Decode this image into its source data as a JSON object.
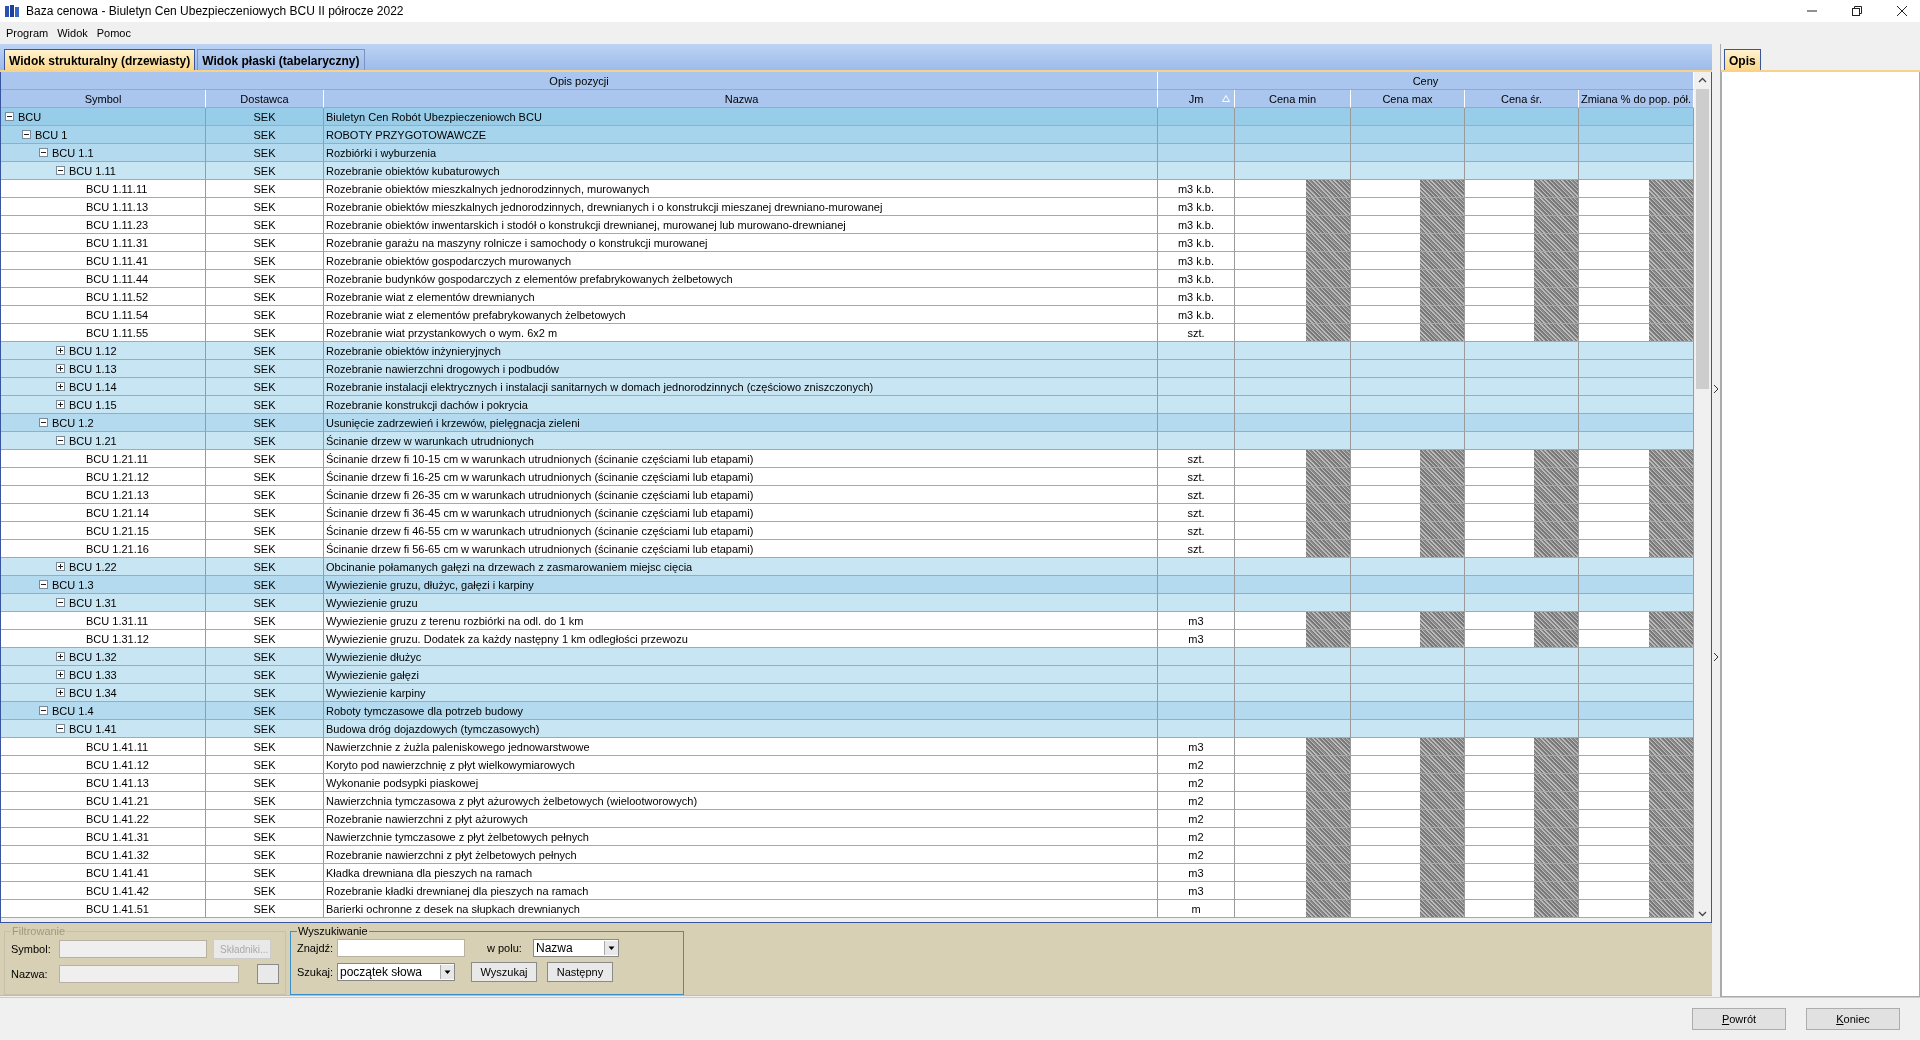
{
  "window": {
    "title": "Baza cenowa - Biuletyn Cen Ubezpieczeniowych BCU II półrocze 2022"
  },
  "menu": [
    "Program",
    "Widok",
    "Pomoc"
  ],
  "tabs": [
    {
      "label": "Widok strukturalny (drzewiasty)",
      "selected": true
    },
    {
      "label": "Widok płaski (tabelaryczny)",
      "selected": false
    }
  ],
  "table": {
    "column_groups": [
      "Opis pozycji",
      "Ceny"
    ],
    "columns": [
      "Symbol",
      "Dostawca",
      "Nazwa",
      "Jm",
      "Cena min",
      "Cena max",
      "Cena śr.",
      "Zmiana % do pop. pół."
    ],
    "rows": [
      {
        "symbol": "BCU",
        "supplier": "SEK",
        "name": "Biuletyn Cen Robót Ubezpieczeniowch BCU",
        "expanded": true,
        "children": [
          {
            "symbol": "BCU 1",
            "supplier": "SEK",
            "name": "ROBOTY PRZYGOTOWAWCZE",
            "expanded": true,
            "children": [
              {
                "symbol": "BCU 1.1",
                "supplier": "SEK",
                "name": "Rozbiórki i wyburzenia",
                "expanded": true,
                "children": [
                  {
                    "symbol": "BCU 1.11",
                    "supplier": "SEK",
                    "name": "Rozebranie obiektów kubaturowych",
                    "expanded": true,
                    "children": [
                      {
                        "symbol": "BCU 1.11.11",
                        "supplier": "SEK",
                        "name": "Rozebranie obiektów mieszkalnych jednorodzinnych, murowanych",
                        "unit": "m3 k.b.",
                        "prices_obscured": true
                      },
                      {
                        "symbol": "BCU 1.11.13",
                        "supplier": "SEK",
                        "name": "Rozebranie obiektów mieszkalnych jednorodzinnych, drewnianych i o konstrukcji mieszanej drewniano-murowanej",
                        "unit": "m3 k.b.",
                        "prices_obscured": true
                      },
                      {
                        "symbol": "BCU 1.11.23",
                        "supplier": "SEK",
                        "name": "Rozebranie obiektów inwentarskich i stodół o konstrukcji drewnianej, murowanej lub murowano-drewnianej",
                        "unit": "m3 k.b.",
                        "prices_obscured": true
                      },
                      {
                        "symbol": "BCU 1.11.31",
                        "supplier": "SEK",
                        "name": "Rozebranie garażu na maszyny rolnicze i samochody o konstrukcji murowanej",
                        "unit": "m3 k.b.",
                        "prices_obscured": true
                      },
                      {
                        "symbol": "BCU 1.11.41",
                        "supplier": "SEK",
                        "name": "Rozebranie obiektów gospodarczych murowanych",
                        "unit": "m3 k.b.",
                        "prices_obscured": true
                      },
                      {
                        "symbol": "BCU 1.11.44",
                        "supplier": "SEK",
                        "name": "Rozebranie budynków gospodarczych z elementów prefabrykowanych żelbetowych",
                        "unit": "m3 k.b.",
                        "prices_obscured": true
                      },
                      {
                        "symbol": "BCU 1.11.52",
                        "supplier": "SEK",
                        "name": "Rozebranie wiat z elementów drewnianych",
                        "unit": "m3 k.b.",
                        "prices_obscured": true
                      },
                      {
                        "symbol": "BCU 1.11.54",
                        "supplier": "SEK",
                        "name": "Rozebranie wiat z elementów prefabrykowanych żelbetowych",
                        "unit": "m3 k.b.",
                        "prices_obscured": true
                      },
                      {
                        "symbol": "BCU 1.11.55",
                        "supplier": "SEK",
                        "name": "Rozebranie wiat przystankowych o wym. 6x2 m",
                        "unit": "szt.",
                        "prices_obscured": true
                      }
                    ]
                  },
                  {
                    "symbol": "BCU 1.12",
                    "supplier": "SEK",
                    "name": "Rozebranie obiektów inżynieryjnych",
                    "expanded": false
                  },
                  {
                    "symbol": "BCU 1.13",
                    "supplier": "SEK",
                    "name": "Rozebranie nawierzchni drogowych i podbudów",
                    "expanded": false
                  },
                  {
                    "symbol": "BCU 1.14",
                    "supplier": "SEK",
                    "name": "Rozebranie instalacji elektrycznych i instalacji sanitarnych w domach jednorodzinnych (częściowo zniszczonych)",
                    "expanded": false
                  },
                  {
                    "symbol": "BCU 1.15",
                    "supplier": "SEK",
                    "name": "Rozebranie konstrukcji dachów i pokrycia",
                    "expanded": false
                  }
                ]
              },
              {
                "symbol": "BCU 1.2",
                "supplier": "SEK",
                "name": "Usunięcie zadrzewień i krzewów, pielęgnacja zieleni",
                "expanded": true,
                "children": [
                  {
                    "symbol": "BCU 1.21",
                    "supplier": "SEK",
                    "name": "Ścinanie drzew w warunkach utrudnionych",
                    "expanded": true,
                    "children": [
                      {
                        "symbol": "BCU 1.21.11",
                        "supplier": "SEK",
                        "name": "Ścinanie drzew fi 10-15 cm w warunkach utrudnionych (ścinanie częściami lub etapami)",
                        "unit": "szt.",
                        "prices_obscured": true
                      },
                      {
                        "symbol": "BCU 1.21.12",
                        "supplier": "SEK",
                        "name": "Ścinanie drzew fi 16-25 cm w warunkach utrudnionych (ścinanie częściami lub etapami)",
                        "unit": "szt.",
                        "prices_obscured": true
                      },
                      {
                        "symbol": "BCU 1.21.13",
                        "supplier": "SEK",
                        "name": "Ścinanie drzew fi 26-35 cm w warunkach utrudnionych (ścinanie częściami lub etapami)",
                        "unit": "szt.",
                        "prices_obscured": true
                      },
                      {
                        "symbol": "BCU 1.21.14",
                        "supplier": "SEK",
                        "name": "Ścinanie drzew fi 36-45 cm w warunkach utrudnionych (ścinanie częściami lub etapami)",
                        "unit": "szt.",
                        "prices_obscured": true
                      },
                      {
                        "symbol": "BCU 1.21.15",
                        "supplier": "SEK",
                        "name": "Ścinanie drzew fi 46-55 cm w warunkach utrudnionych (ścinanie częściami lub etapami)",
                        "unit": "szt.",
                        "prices_obscured": true
                      },
                      {
                        "symbol": "BCU 1.21.16",
                        "supplier": "SEK",
                        "name": "Ścinanie drzew fi 56-65 cm w warunkach utrudnionych (ścinanie częściami lub etapami)",
                        "unit": "szt.",
                        "prices_obscured": true
                      }
                    ]
                  },
                  {
                    "symbol": "BCU 1.22",
                    "supplier": "SEK",
                    "name": "Obcinanie połamanych gałęzi na drzewach z zasmarowaniem miejsc cięcia",
                    "expanded": false
                  }
                ]
              },
              {
                "symbol": "BCU 1.3",
                "supplier": "SEK",
                "name": "Wywiezienie gruzu, dłużyc, gałęzi i karpiny",
                "expanded": true,
                "children": [
                  {
                    "symbol": "BCU 1.31",
                    "supplier": "SEK",
                    "name": "Wywiezienie gruzu",
                    "expanded": true,
                    "children": [
                      {
                        "symbol": "BCU 1.31.11",
                        "supplier": "SEK",
                        "name": "Wywiezienie gruzu z terenu rozbiórki na odl. do 1 km",
                        "unit": "m3",
                        "prices_obscured": true
                      },
                      {
                        "symbol": "BCU 1.31.12",
                        "supplier": "SEK",
                        "name": "Wywiezienie gruzu. Dodatek za każdy następny 1 km odległości przewozu",
                        "unit": "m3",
                        "prices_obscured": true
                      }
                    ]
                  },
                  {
                    "symbol": "BCU 1.32",
                    "supplier": "SEK",
                    "name": "Wywiezienie dłużyc",
                    "expanded": false
                  },
                  {
                    "symbol": "BCU 1.33",
                    "supplier": "SEK",
                    "name": "Wywiezienie gałęzi",
                    "expanded": false
                  },
                  {
                    "symbol": "BCU 1.34",
                    "supplier": "SEK",
                    "name": "Wywiezienie karpiny",
                    "expanded": false
                  }
                ]
              },
              {
                "symbol": "BCU 1.4",
                "supplier": "SEK",
                "name": "Roboty tymczasowe dla potrzeb budowy",
                "expanded": true,
                "children": [
                  {
                    "symbol": "BCU 1.41",
                    "supplier": "SEK",
                    "name": "Budowa dróg dojazdowych (tymczasowych)",
                    "expanded": true,
                    "children": [
                      {
                        "symbol": "BCU 1.41.11",
                        "supplier": "SEK",
                        "name": "Nawierzchnie z żużla paleniskowego jednowarstwowe",
                        "unit": "m3",
                        "prices_obscured": true
                      },
                      {
                        "symbol": "BCU 1.41.12",
                        "supplier": "SEK",
                        "name": "Koryto pod nawierzchnię z płyt wielkowymiarowych",
                        "unit": "m2",
                        "prices_obscured": true
                      },
                      {
                        "symbol": "BCU 1.41.13",
                        "supplier": "SEK",
                        "name": "Wykonanie podsypki piaskowej",
                        "unit": "m2",
                        "prices_obscured": true
                      },
                      {
                        "symbol": "BCU 1.41.21",
                        "supplier": "SEK",
                        "name": "Nawierzchnia tymczasowa z płyt ażurowych żelbetowych (wielootworowych)",
                        "unit": "m2",
                        "prices_obscured": true
                      },
                      {
                        "symbol": "BCU 1.41.22",
                        "supplier": "SEK",
                        "name": "Rozebranie nawierzchni z płyt ażurowych",
                        "unit": "m2",
                        "prices_obscured": true
                      },
                      {
                        "symbol": "BCU 1.41.31",
                        "supplier": "SEK",
                        "name": "Nawierzchnie tymczasowe z płyt żelbetowych pełnych",
                        "unit": "m2",
                        "prices_obscured": true
                      },
                      {
                        "symbol": "BCU 1.41.32",
                        "supplier": "SEK",
                        "name": "Rozebranie nawierzchni z płyt żelbetowych pełnych",
                        "unit": "m2",
                        "prices_obscured": true
                      },
                      {
                        "symbol": "BCU 1.41.41",
                        "supplier": "SEK",
                        "name": "Kładka drewniana dla pieszych na ramach",
                        "unit": "m3",
                        "prices_obscured": true
                      },
                      {
                        "symbol": "BCU 1.41.42",
                        "supplier": "SEK",
                        "name": "Rozebranie kładki drewnianej dla pieszych na ramach",
                        "unit": "m3",
                        "prices_obscured": true
                      },
                      {
                        "symbol": "BCU 1.41.51",
                        "supplier": "SEK",
                        "name": "Barierki ochronne z desek na słupkach drewnianych",
                        "unit": "m",
                        "prices_obscured": true
                      }
                    ]
                  }
                ]
              }
            ]
          }
        ]
      }
    ]
  },
  "filter": {
    "title": "Filtrowanie",
    "disabled": true,
    "symbol_label": "Symbol:",
    "components_button": "Składniki...",
    "name_label": "Nazwa:"
  },
  "search": {
    "title": "Wyszukiwanie",
    "find_label": "Znajdź:",
    "field_label": "w polu:",
    "field_value": "Nazwa",
    "mode_label": "Szukaj:",
    "mode_value": "początek słowa",
    "buttons": [
      "Wyszukaj",
      "Następny"
    ]
  },
  "side_panel": {
    "tabs": [
      {
        "label": "Opis",
        "selected": true
      }
    ]
  },
  "buttons": [
    "Powrót",
    "Koniec"
  ]
}
